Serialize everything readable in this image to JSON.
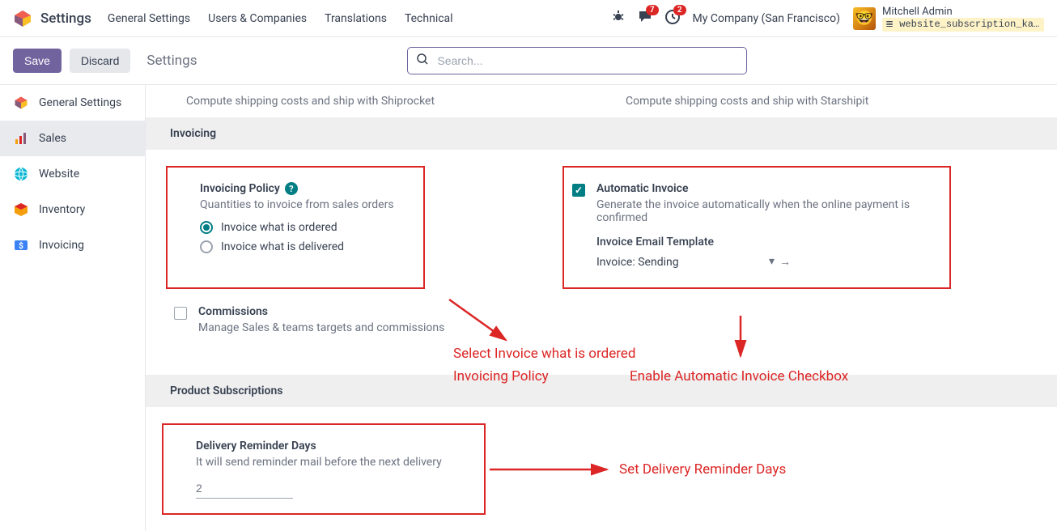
{
  "topnav": {
    "app_title": "Settings",
    "menu": [
      "General Settings",
      "Users & Companies",
      "Translations",
      "Technical"
    ],
    "messages_badge": "7",
    "activities_badge": "2",
    "company": "My Company (San Francisco)",
    "username": "Mitchell Admin",
    "user_context": "website_subscription_kan..."
  },
  "controlbar": {
    "save": "Save",
    "discard": "Discard",
    "breadcrumb": "Settings",
    "search_placeholder": "Search..."
  },
  "sidebar": {
    "items": [
      {
        "label": "General Settings"
      },
      {
        "label": "Sales"
      },
      {
        "label": "Website"
      },
      {
        "label": "Inventory"
      },
      {
        "label": "Invoicing"
      }
    ]
  },
  "top_row": {
    "left_desc": "Compute shipping costs and ship with Shiprocket",
    "right_desc": "Compute shipping costs and ship with Starshipit"
  },
  "sections": {
    "invoicing_header": "Invoicing",
    "product_subscriptions_header": "Product Subscriptions"
  },
  "invoicing_policy": {
    "title": "Invoicing Policy",
    "desc": "Quantities to invoice from sales orders",
    "option_ordered": "Invoice what is ordered",
    "option_delivered": "Invoice what is delivered"
  },
  "automatic_invoice": {
    "title": "Automatic Invoice",
    "desc": "Generate the invoice automatically when the online payment is confirmed",
    "template_label": "Invoice Email Template",
    "template_value": "Invoice: Sending"
  },
  "commissions": {
    "title": "Commissions",
    "desc": "Manage Sales & teams targets and commissions"
  },
  "delivery_reminder": {
    "title": "Delivery Reminder Days",
    "desc": "It will send reminder mail before the next delivery",
    "value": "2"
  },
  "annotations": {
    "policy_line1": "Select Invoice what is ordered",
    "policy_line2": "Invoicing Policy",
    "automatic": "Enable Automatic Invoice Checkbox",
    "reminder": "Set Delivery Reminder Days"
  }
}
